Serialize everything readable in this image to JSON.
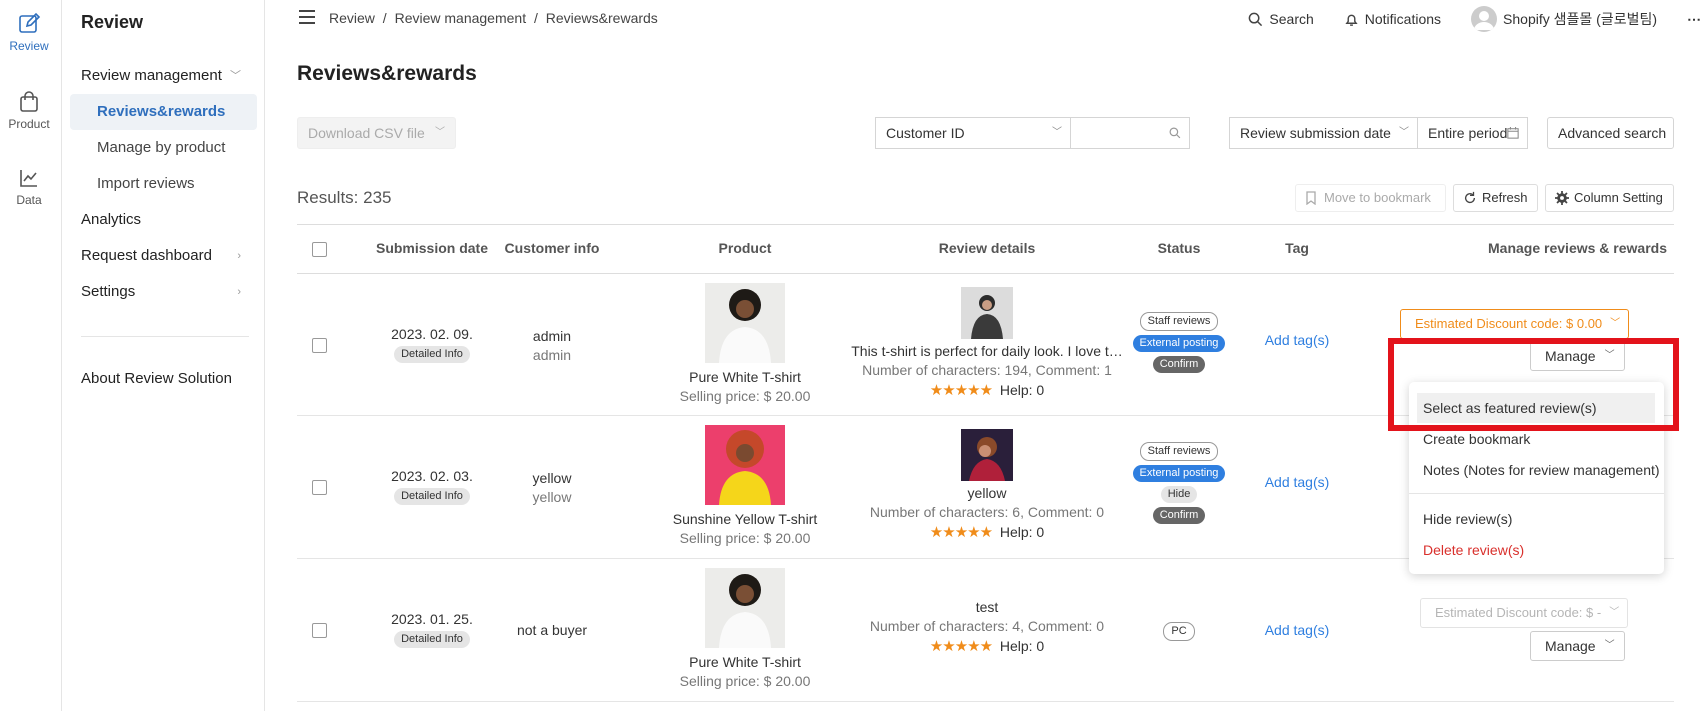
{
  "rail": [
    {
      "label": "Review",
      "icon": "edit-icon",
      "active": true
    },
    {
      "label": "Product",
      "icon": "shopping-bag-icon",
      "active": false
    },
    {
      "label": "Data",
      "icon": "line-chart-icon",
      "active": false
    }
  ],
  "sidebar": {
    "title": "Review",
    "review_management": "Review management",
    "sub": [
      "Reviews&rewards",
      "Manage by product",
      "Import reviews"
    ],
    "analytics": "Analytics",
    "request_dashboard": "Request dashboard",
    "settings": "Settings",
    "about": "About Review Solution"
  },
  "topbar": {
    "crumbs": [
      "Review",
      "/",
      "Review management",
      "/",
      "Reviews&rewards"
    ],
    "search": "Search",
    "notifications": "Notifications",
    "shop": "Shopify 샘플몰 (글로벌팀)"
  },
  "page": {
    "title": "Reviews&rewards"
  },
  "filters": {
    "download": "Download CSV file",
    "customer_id": "Customer ID",
    "search_value": "",
    "date_type": "Review submission date",
    "period": "Entire period",
    "advanced": "Advanced search"
  },
  "results": "Results: 235",
  "actions": {
    "bookmark": "Move to bookmark",
    "refresh": "Refresh",
    "columns": "Column Setting"
  },
  "columns": [
    "Submission date",
    "Customer info",
    "Product",
    "Review details",
    "Status",
    "Tag",
    "Manage reviews & rewards"
  ],
  "rows": [
    {
      "date": "2023. 02. 09.",
      "detail": "Detailed Info",
      "customer_name": "admin",
      "customer_id": "admin",
      "product": "Pure White T-shirt",
      "price": "Selling price: $ 20.00",
      "review_text": "This t-shirt is perfect for daily look. I love t…",
      "review_meta": "Number of characters: 194, Comment: 1",
      "stars": "★★★★★",
      "help": "Help: 0",
      "badges": [
        {
          "text": "Staff reviews",
          "style": "outline"
        },
        {
          "text": "External posting",
          "style": "blue"
        },
        {
          "text": "Confirm",
          "style": "gray"
        }
      ],
      "tag": "Add tag(s)",
      "estimated": "Estimated Discount code: $ 0.00",
      "manage": "Manage"
    },
    {
      "date": "2023. 02. 03.",
      "detail": "Detailed Info",
      "customer_name": "yellow",
      "customer_id": "yellow",
      "product": "Sunshine Yellow T-shirt",
      "price": "Selling price: $ 20.00",
      "review_text": "yellow",
      "review_meta": "Number of characters: 6, Comment: 0",
      "stars": "★★★★★",
      "help": "Help: 0",
      "badges": [
        {
          "text": "Staff reviews",
          "style": "outline"
        },
        {
          "text": "External posting",
          "style": "blue"
        },
        {
          "text": "Hide",
          "style": "light"
        },
        {
          "text": "Confirm",
          "style": "gray"
        }
      ],
      "tag": "Add tag(s)"
    },
    {
      "date": "2023. 01. 25.",
      "detail": "Detailed Info",
      "customer_name": "not a buyer",
      "product": "Pure White T-shirt",
      "price": "Selling price: $ 20.00",
      "review_text": "test",
      "review_meta": "Number of characters: 4, Comment: 0",
      "stars": "★★★★★",
      "help": "Help: 0",
      "badges": [
        {
          "text": "PC",
          "style": "outline"
        }
      ],
      "tag": "Add tag(s)",
      "estimated": "Estimated Discount code: $ -",
      "manage": "Manage"
    }
  ],
  "dropdown": {
    "items": [
      "Select as featured review(s)",
      "Create bookmark",
      "Notes (Notes for review management)",
      "Hide review(s)",
      "Delete review(s)"
    ]
  },
  "colors": {
    "accent": "#2f7fe0",
    "orange": "#f08c1a",
    "danger": "#d9302c",
    "highlight_box": "#e3131b"
  }
}
